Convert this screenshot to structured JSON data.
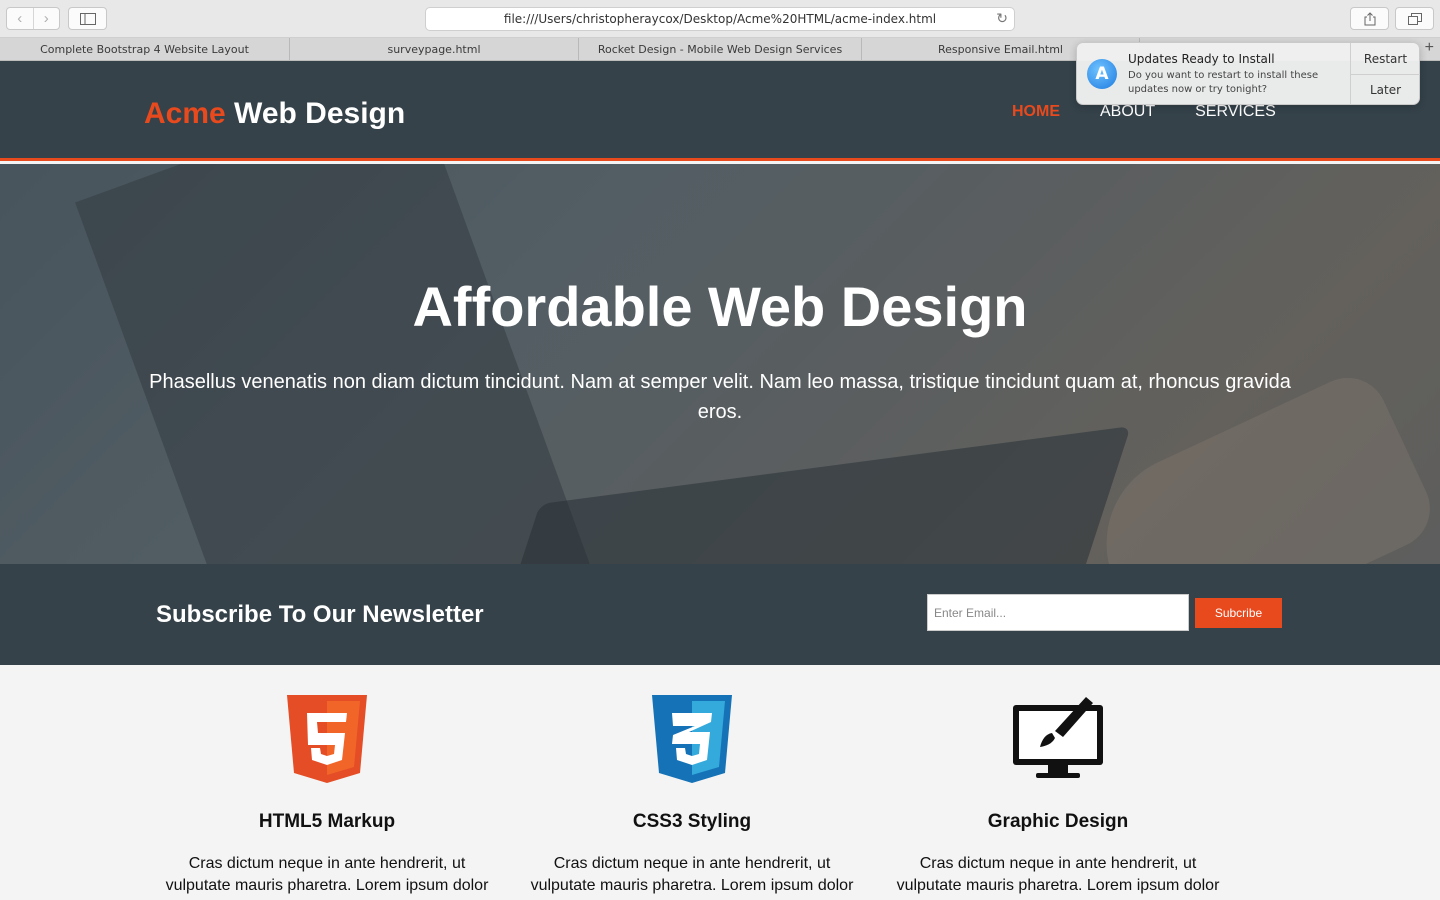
{
  "browser": {
    "url": "file:///Users/christopheraycox/Desktop/Acme%20HTML/acme-index.html",
    "tabs": [
      {
        "label": "Complete Bootstrap 4 Website Layout"
      },
      {
        "label": "surveypage.html"
      },
      {
        "label": "Rocket Design - Mobile Web Design Services"
      },
      {
        "label": "Responsive Email.html"
      }
    ]
  },
  "notification": {
    "title": "Updates Ready to Install",
    "body": "Do you want to restart to install these updates now or try tonight?",
    "restart_label": "Restart",
    "later_label": "Later",
    "icon": "app-store-icon"
  },
  "header": {
    "brand_accent": "Acme",
    "brand_rest": " Web Design",
    "nav": [
      {
        "label": "Home",
        "active": true
      },
      {
        "label": "About",
        "active": false
      },
      {
        "label": "Services",
        "active": false
      }
    ]
  },
  "hero": {
    "title": "Affordable Web Design",
    "text": "Phasellus venenatis non diam dictum tincidunt. Nam at semper velit. Nam leo massa, tristique tincidunt quam at, rhoncus gravida eros."
  },
  "newsletter": {
    "title": "Subscribe To Our Newsletter",
    "placeholder": "Enter Email...",
    "button_label": "Subcribe"
  },
  "boxes": [
    {
      "title": "HTML5 Markup",
      "text": "Cras dictum neque in ante hendrerit, ut vulputate mauris pharetra. Lorem ipsum dolor sit amet,",
      "icon": "html5-icon"
    },
    {
      "title": "CSS3 Styling",
      "text": "Cras dictum neque in ante hendrerit, ut vulputate mauris pharetra. Lorem ipsum dolor sit amet,",
      "icon": "css3-icon"
    },
    {
      "title": "Graphic Design",
      "text": "Cras dictum neque in ante hendrerit, ut vulputate mauris pharetra. Lorem ipsum dolor sit amet,",
      "icon": "monitor-brush-icon"
    }
  ],
  "colors": {
    "brand_dark": "#35424a",
    "accent": "#e8491d",
    "page_bg": "#f4f4f4"
  }
}
